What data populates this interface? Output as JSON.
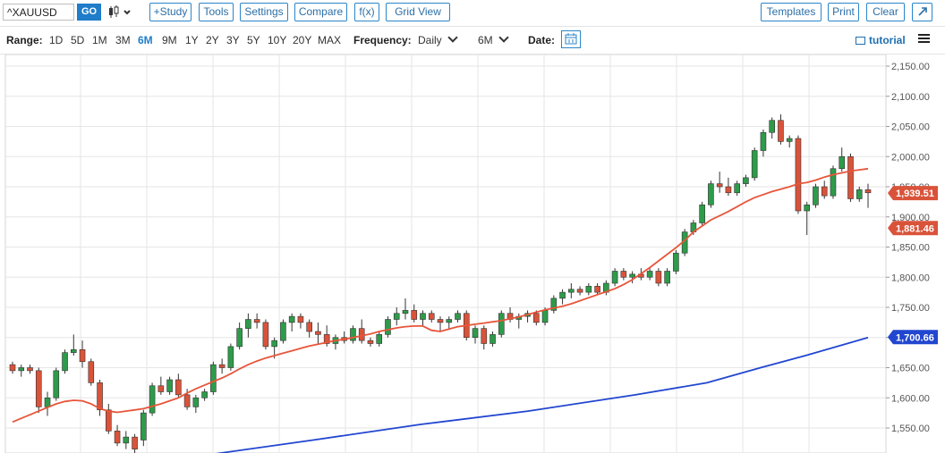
{
  "toolbar": {
    "symbol_value": "^XAUUSD",
    "go_label": "GO",
    "study_label": "+Study",
    "tools_label": "Tools",
    "settings_label": "Settings",
    "compare_label": "Compare",
    "fx_label": "f(x)",
    "grid_view_label": "Grid View",
    "templates_label": "Templates",
    "print_label": "Print",
    "clear_label": "Clear",
    "expand_icon": "expand-arrow-icon"
  },
  "rangebar": {
    "range_label": "Range:",
    "ranges": [
      "1D",
      "5D",
      "1M",
      "3M",
      "6M",
      "9M",
      "1Y",
      "2Y",
      "3Y",
      "5Y",
      "10Y",
      "20Y",
      "MAX"
    ],
    "active_range": "6M",
    "frequency_label": "Frequency:",
    "frequency_value": "Daily",
    "period_value": "6M",
    "date_label": "Date:",
    "tutorial_label": "tutorial"
  },
  "colors": {
    "up": "#2e9b4a",
    "down": "#d9533a",
    "ma_fast": "#e8553a",
    "ma_slow": "#2146d0",
    "accent": "#1f7dc9"
  },
  "chart_data": {
    "type": "candlestick",
    "ylim": [
      1520,
      2160
    ],
    "y_ticks": [
      "2,150.00",
      "2,100.00",
      "2,050.00",
      "2,000.00",
      "1,950.00",
      "1,900.00",
      "1,850.00",
      "1,800.00",
      "1,750.00",
      "1,700.00",
      "1,650.00",
      "1,600.00",
      "1,550.00"
    ],
    "y_tick_values": [
      2150,
      2100,
      2050,
      2000,
      1950,
      1900,
      1850,
      1800,
      1750,
      1700,
      1650,
      1600,
      1550
    ],
    "price_labels": [
      {
        "text": "1,939.51",
        "value": 1939.51,
        "color": "#d9533a"
      },
      {
        "text": "1,881.46",
        "value": 1881.46,
        "color": "#d9533a"
      },
      {
        "text": "1,700.66",
        "value": 1700.66,
        "color": "#2146d0"
      }
    ],
    "candles": [
      [
        1655,
        1660,
        1640,
        1645
      ],
      [
        1645,
        1655,
        1635,
        1650
      ],
      [
        1650,
        1655,
        1640,
        1645
      ],
      [
        1645,
        1650,
        1575,
        1585
      ],
      [
        1585,
        1610,
        1570,
        1600
      ],
      [
        1600,
        1650,
        1595,
        1645
      ],
      [
        1645,
        1680,
        1640,
        1675
      ],
      [
        1675,
        1705,
        1670,
        1680
      ],
      [
        1680,
        1695,
        1650,
        1660
      ],
      [
        1660,
        1665,
        1620,
        1625
      ],
      [
        1625,
        1630,
        1570,
        1580
      ],
      [
        1580,
        1590,
        1540,
        1545
      ],
      [
        1545,
        1555,
        1520,
        1525
      ],
      [
        1525,
        1545,
        1515,
        1535
      ],
      [
        1535,
        1540,
        1500,
        1515
      ],
      [
        1530,
        1580,
        1520,
        1575
      ],
      [
        1575,
        1625,
        1570,
        1620
      ],
      [
        1620,
        1635,
        1605,
        1610
      ],
      [
        1610,
        1635,
        1605,
        1630
      ],
      [
        1630,
        1640,
        1600,
        1605
      ],
      [
        1605,
        1615,
        1580,
        1585
      ],
      [
        1585,
        1605,
        1575,
        1600
      ],
      [
        1600,
        1615,
        1595,
        1610
      ],
      [
        1610,
        1660,
        1605,
        1655
      ],
      [
        1655,
        1665,
        1640,
        1650
      ],
      [
        1650,
        1690,
        1645,
        1685
      ],
      [
        1685,
        1725,
        1680,
        1715
      ],
      [
        1715,
        1740,
        1700,
        1730
      ],
      [
        1730,
        1740,
        1715,
        1725
      ],
      [
        1725,
        1730,
        1680,
        1685
      ],
      [
        1685,
        1700,
        1665,
        1695
      ],
      [
        1695,
        1730,
        1690,
        1725
      ],
      [
        1725,
        1740,
        1710,
        1735
      ],
      [
        1735,
        1740,
        1715,
        1725
      ],
      [
        1725,
        1730,
        1700,
        1710
      ],
      [
        1710,
        1725,
        1690,
        1705
      ],
      [
        1705,
        1720,
        1685,
        1690
      ],
      [
        1690,
        1705,
        1680,
        1700
      ],
      [
        1700,
        1710,
        1690,
        1695
      ],
      [
        1695,
        1720,
        1690,
        1715
      ],
      [
        1715,
        1730,
        1690,
        1695
      ],
      [
        1695,
        1700,
        1685,
        1690
      ],
      [
        1690,
        1710,
        1685,
        1705
      ],
      [
        1705,
        1735,
        1700,
        1730
      ],
      [
        1730,
        1750,
        1720,
        1740
      ],
      [
        1740,
        1765,
        1730,
        1745
      ],
      [
        1745,
        1755,
        1725,
        1730
      ],
      [
        1730,
        1745,
        1720,
        1740
      ],
      [
        1740,
        1745,
        1725,
        1730
      ],
      [
        1730,
        1735,
        1710,
        1725
      ],
      [
        1725,
        1735,
        1715,
        1730
      ],
      [
        1730,
        1745,
        1725,
        1740
      ],
      [
        1740,
        1745,
        1695,
        1700
      ],
      [
        1700,
        1720,
        1690,
        1715
      ],
      [
        1715,
        1720,
        1680,
        1690
      ],
      [
        1690,
        1710,
        1685,
        1705
      ],
      [
        1705,
        1745,
        1700,
        1740
      ],
      [
        1740,
        1750,
        1725,
        1730
      ],
      [
        1730,
        1740,
        1715,
        1735
      ],
      [
        1735,
        1745,
        1725,
        1740
      ],
      [
        1740,
        1745,
        1720,
        1725
      ],
      [
        1725,
        1750,
        1720,
        1745
      ],
      [
        1745,
        1770,
        1740,
        1765
      ],
      [
        1765,
        1780,
        1755,
        1775
      ],
      [
        1775,
        1790,
        1765,
        1780
      ],
      [
        1780,
        1785,
        1770,
        1775
      ],
      [
        1775,
        1790,
        1770,
        1785
      ],
      [
        1785,
        1790,
        1770,
        1775
      ],
      [
        1775,
        1795,
        1770,
        1790
      ],
      [
        1790,
        1815,
        1785,
        1810
      ],
      [
        1810,
        1815,
        1795,
        1800
      ],
      [
        1800,
        1810,
        1790,
        1805
      ],
      [
        1805,
        1815,
        1795,
        1800
      ],
      [
        1800,
        1815,
        1795,
        1810
      ],
      [
        1810,
        1815,
        1785,
        1790
      ],
      [
        1790,
        1815,
        1785,
        1810
      ],
      [
        1810,
        1845,
        1805,
        1840
      ],
      [
        1840,
        1880,
        1835,
        1875
      ],
      [
        1875,
        1895,
        1870,
        1890
      ],
      [
        1890,
        1925,
        1885,
        1920
      ],
      [
        1920,
        1960,
        1915,
        1955
      ],
      [
        1955,
        1975,
        1940,
        1950
      ],
      [
        1950,
        1965,
        1935,
        1940
      ],
      [
        1940,
        1960,
        1935,
        1955
      ],
      [
        1955,
        1970,
        1950,
        1965
      ],
      [
        1965,
        2015,
        1960,
        2010
      ],
      [
        2010,
        2045,
        2000,
        2040
      ],
      [
        2040,
        2065,
        2030,
        2060
      ],
      [
        2060,
        2070,
        2020,
        2025
      ],
      [
        2025,
        2035,
        2015,
        2030
      ],
      [
        2030,
        2035,
        1905,
        1910
      ],
      [
        1910,
        1925,
        1870,
        1920
      ],
      [
        1920,
        1955,
        1915,
        1950
      ],
      [
        1950,
        1960,
        1930,
        1935
      ],
      [
        1935,
        1985,
        1930,
        1980
      ],
      [
        1980,
        2015,
        1975,
        2000
      ],
      [
        2000,
        2005,
        1925,
        1930
      ],
      [
        1930,
        1950,
        1925,
        1945
      ],
      [
        1945,
        1955,
        1915,
        1940
      ]
    ],
    "ma_fast": [
      1560,
      1566,
      1572,
      1578,
      1584,
      1590,
      1594,
      1596,
      1595,
      1590,
      1582,
      1578,
      1576,
      1578,
      1580,
      1582,
      1586,
      1590,
      1595,
      1600,
      1608,
      1615,
      1621,
      1627,
      1633,
      1640,
      1648,
      1655,
      1661,
      1666,
      1670,
      1674,
      1678,
      1682,
      1686,
      1689,
      1692,
      1695,
      1697,
      1700,
      1703,
      1706,
      1710,
      1713,
      1716,
      1718,
      1719,
      1719,
      1712,
      1710,
      1714,
      1718,
      1720,
      1722,
      1724,
      1726,
      1728,
      1731,
      1734,
      1738,
      1742,
      1746,
      1749,
      1752,
      1756,
      1761,
      1766,
      1771,
      1776,
      1781,
      1788,
      1796,
      1806,
      1816,
      1827,
      1838,
      1849,
      1861,
      1875,
      1885,
      1895,
      1902,
      1909,
      1917,
      1925,
      1932,
      1937,
      1942,
      1946,
      1950,
      1955,
      1957,
      1961,
      1966,
      1970,
      1973,
      1976,
      1978,
      1980,
      1882
    ],
    "ma_slow_points": [
      [
        230,
        1505
      ],
      [
        350,
        1530
      ],
      [
        470,
        1556
      ],
      [
        590,
        1578
      ],
      [
        710,
        1605
      ],
      [
        790,
        1625
      ],
      [
        850,
        1650
      ],
      [
        900,
        1670
      ],
      [
        970,
        1700
      ]
    ]
  }
}
